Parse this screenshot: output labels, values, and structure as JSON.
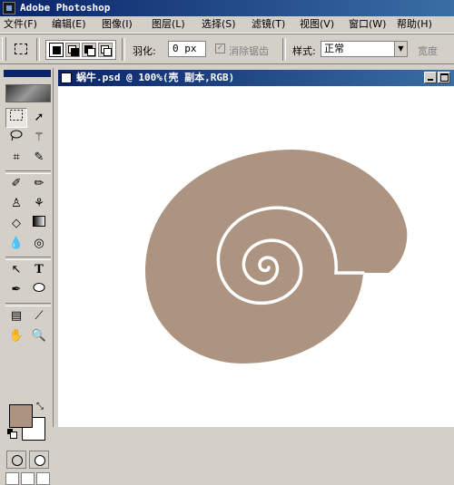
{
  "app": {
    "title": "Adobe Photoshop"
  },
  "menu": [
    {
      "label": "文件(F)"
    },
    {
      "label": "编辑(E)"
    },
    {
      "label": "图像(I)"
    },
    {
      "label": "图层(L)"
    },
    {
      "label": "选择(S)"
    },
    {
      "label": "滤镜(T)"
    },
    {
      "label": "视图(V)"
    },
    {
      "label": "窗口(W)"
    },
    {
      "label": "帮助(H)"
    }
  ],
  "options_bar": {
    "feather_label": "羽化:",
    "feather_value": "0 px",
    "antialias_label": "消除锯齿",
    "antialias_checked": true,
    "style_label": "样式:",
    "style_value": "正常",
    "width_label": "宽度"
  },
  "document": {
    "title": "蜗牛.psd @ 100%(壳 副本,RGB)"
  },
  "colors": {
    "foreground": "#ad9480",
    "background": "#ffffff",
    "shell_fill": "#ad9480",
    "title_bar": "#0a246a"
  },
  "toolbox": {
    "text_tool_glyph": "T"
  }
}
